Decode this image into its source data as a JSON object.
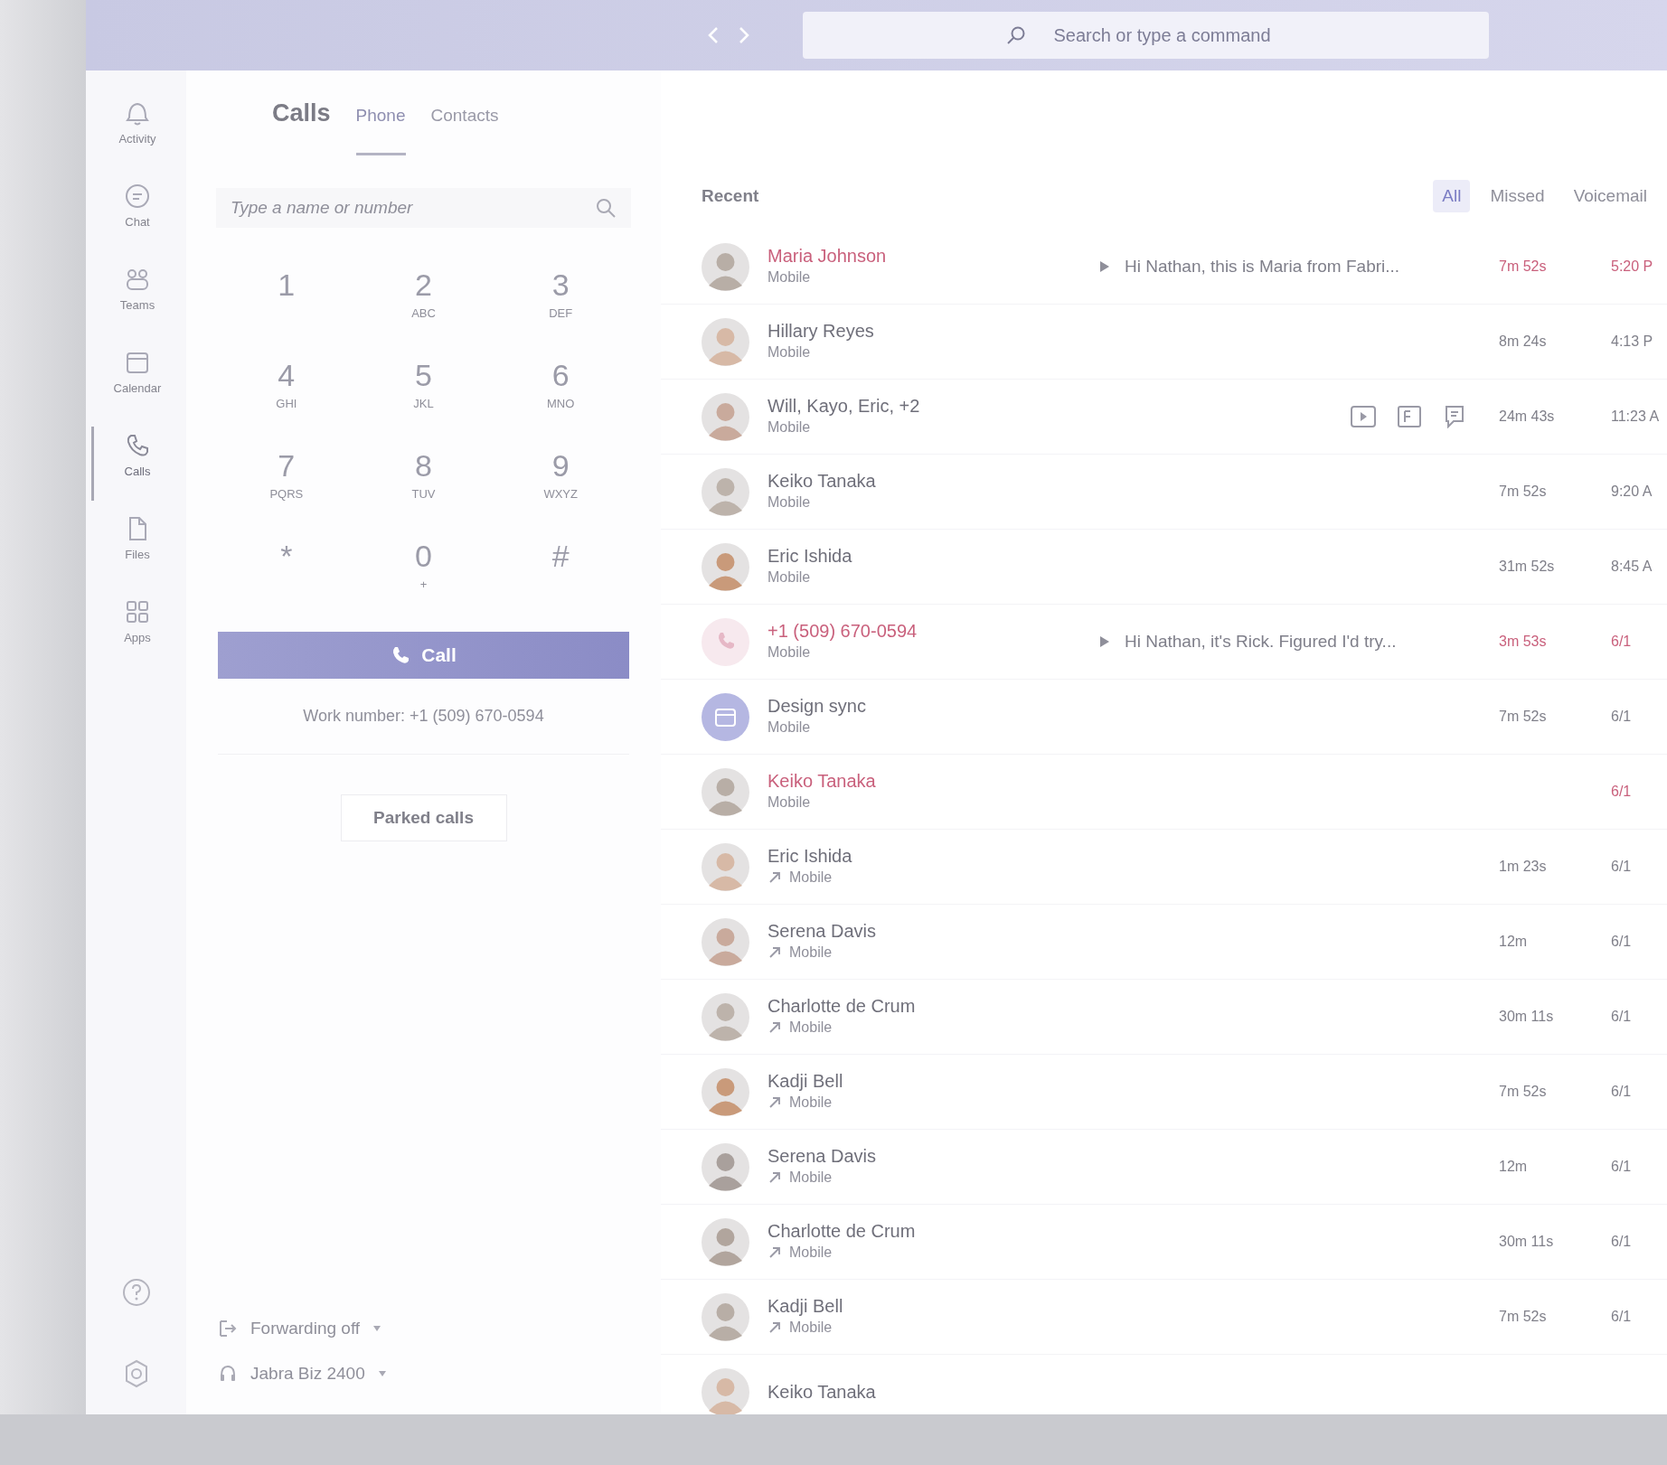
{
  "top_bar": {
    "search_placeholder": "Search or type a command"
  },
  "rail": {
    "items": [
      {
        "label": "Activity",
        "selected": false
      },
      {
        "label": "Chat",
        "selected": false
      },
      {
        "label": "Teams",
        "selected": false
      },
      {
        "label": "Calendar",
        "selected": false
      },
      {
        "label": "Calls",
        "selected": true
      },
      {
        "label": "Files",
        "selected": false
      },
      {
        "label": "Apps",
        "selected": false
      }
    ]
  },
  "calls_panel": {
    "title": "Calls",
    "tabs": [
      {
        "label": "Phone",
        "selected": true
      },
      {
        "label": "Contacts",
        "selected": false
      }
    ],
    "search_placeholder": "Type a name or number",
    "keypad": [
      {
        "digit": "1"
      },
      {
        "digit": "2",
        "letters": "ABC"
      },
      {
        "digit": "3",
        "letters": "DEF"
      },
      {
        "digit": "4",
        "letters": "GHI"
      },
      {
        "digit": "5",
        "letters": "JKL"
      },
      {
        "digit": "6",
        "letters": "MNO"
      },
      {
        "digit": "7",
        "letters": "PQRS"
      },
      {
        "digit": "8",
        "letters": "TUV"
      },
      {
        "digit": "9",
        "letters": "WXYZ"
      },
      {
        "digit": "*"
      },
      {
        "digit": "0",
        "letters": "+"
      },
      {
        "digit": "#"
      }
    ],
    "call_button": "Call",
    "work_number": "Work number: +1 (509) 670-0594",
    "parked_button": "Parked calls",
    "footer": [
      {
        "label": "Forwarding off"
      },
      {
        "label": "Jabra Biz 2400"
      }
    ]
  },
  "recent": {
    "title": "Recent",
    "filters": [
      {
        "label": "All",
        "selected": true
      },
      {
        "label": "Missed",
        "selected": false
      },
      {
        "label": "Voicemail",
        "selected": false
      }
    ],
    "rows": [
      {
        "name": "Maria Johnson",
        "subtitle": "Mobile",
        "kind": "person",
        "missed": true,
        "outgoing": false,
        "preview": "Hi Nathan, this is Maria from Fabri...",
        "duration": "7m 52s",
        "time": "5:20 P"
      },
      {
        "name": "Hillary Reyes",
        "subtitle": "Mobile",
        "kind": "person",
        "missed": false,
        "outgoing": false,
        "duration": "8m 24s",
        "time": "4:13 P"
      },
      {
        "name": "Will, Kayo, Eric, +2",
        "subtitle": "Mobile",
        "kind": "person",
        "missed": false,
        "outgoing": false,
        "actions": true,
        "duration": "24m 43s",
        "time": "11:23 A"
      },
      {
        "name": "Keiko Tanaka",
        "subtitle": "Mobile",
        "kind": "person",
        "missed": false,
        "outgoing": false,
        "duration": "7m 52s",
        "time": "9:20 A"
      },
      {
        "name": "Eric Ishida",
        "subtitle": "Mobile",
        "kind": "person",
        "missed": false,
        "outgoing": false,
        "duration": "31m 52s",
        "time": "8:45 A"
      },
      {
        "name": "+1 (509) 670-0594",
        "subtitle": "Mobile",
        "kind": "number",
        "missed": true,
        "outgoing": false,
        "preview": "Hi Nathan, it's Rick. Figured I'd try...",
        "duration": "3m 53s",
        "time": "6/1"
      },
      {
        "name": "Design sync",
        "subtitle": "Mobile",
        "kind": "meeting",
        "missed": false,
        "outgoing": false,
        "duration": "7m 52s",
        "time": "6/1"
      },
      {
        "name": "Keiko Tanaka",
        "subtitle": "Mobile",
        "kind": "person",
        "missed": true,
        "outgoing": false,
        "time": "6/1"
      },
      {
        "name": "Eric Ishida",
        "subtitle": "Mobile",
        "kind": "person",
        "missed": false,
        "outgoing": true,
        "duration": "1m 23s",
        "time": "6/1"
      },
      {
        "name": "Serena Davis",
        "subtitle": "Mobile",
        "kind": "person",
        "missed": false,
        "outgoing": true,
        "duration": "12m",
        "time": "6/1"
      },
      {
        "name": "Charlotte de Crum",
        "subtitle": "Mobile",
        "kind": "person",
        "missed": false,
        "outgoing": true,
        "duration": "30m 11s",
        "time": "6/1"
      },
      {
        "name": "Kadji Bell",
        "subtitle": "Mobile",
        "kind": "person",
        "missed": false,
        "outgoing": true,
        "duration": "7m 52s",
        "time": "6/1"
      },
      {
        "name": "Serena Davis",
        "subtitle": "Mobile",
        "kind": "person",
        "missed": false,
        "outgoing": true,
        "duration": "12m",
        "time": "6/1"
      },
      {
        "name": "Charlotte de Crum",
        "subtitle": "Mobile",
        "kind": "person",
        "missed": false,
        "outgoing": true,
        "duration": "30m 11s",
        "time": "6/1"
      },
      {
        "name": "Kadji Bell",
        "subtitle": "Mobile",
        "kind": "person",
        "missed": false,
        "outgoing": true,
        "duration": "7m 52s",
        "time": "6/1"
      },
      {
        "name": "Keiko Tanaka",
        "kind": "person",
        "missed": false
      }
    ]
  }
}
